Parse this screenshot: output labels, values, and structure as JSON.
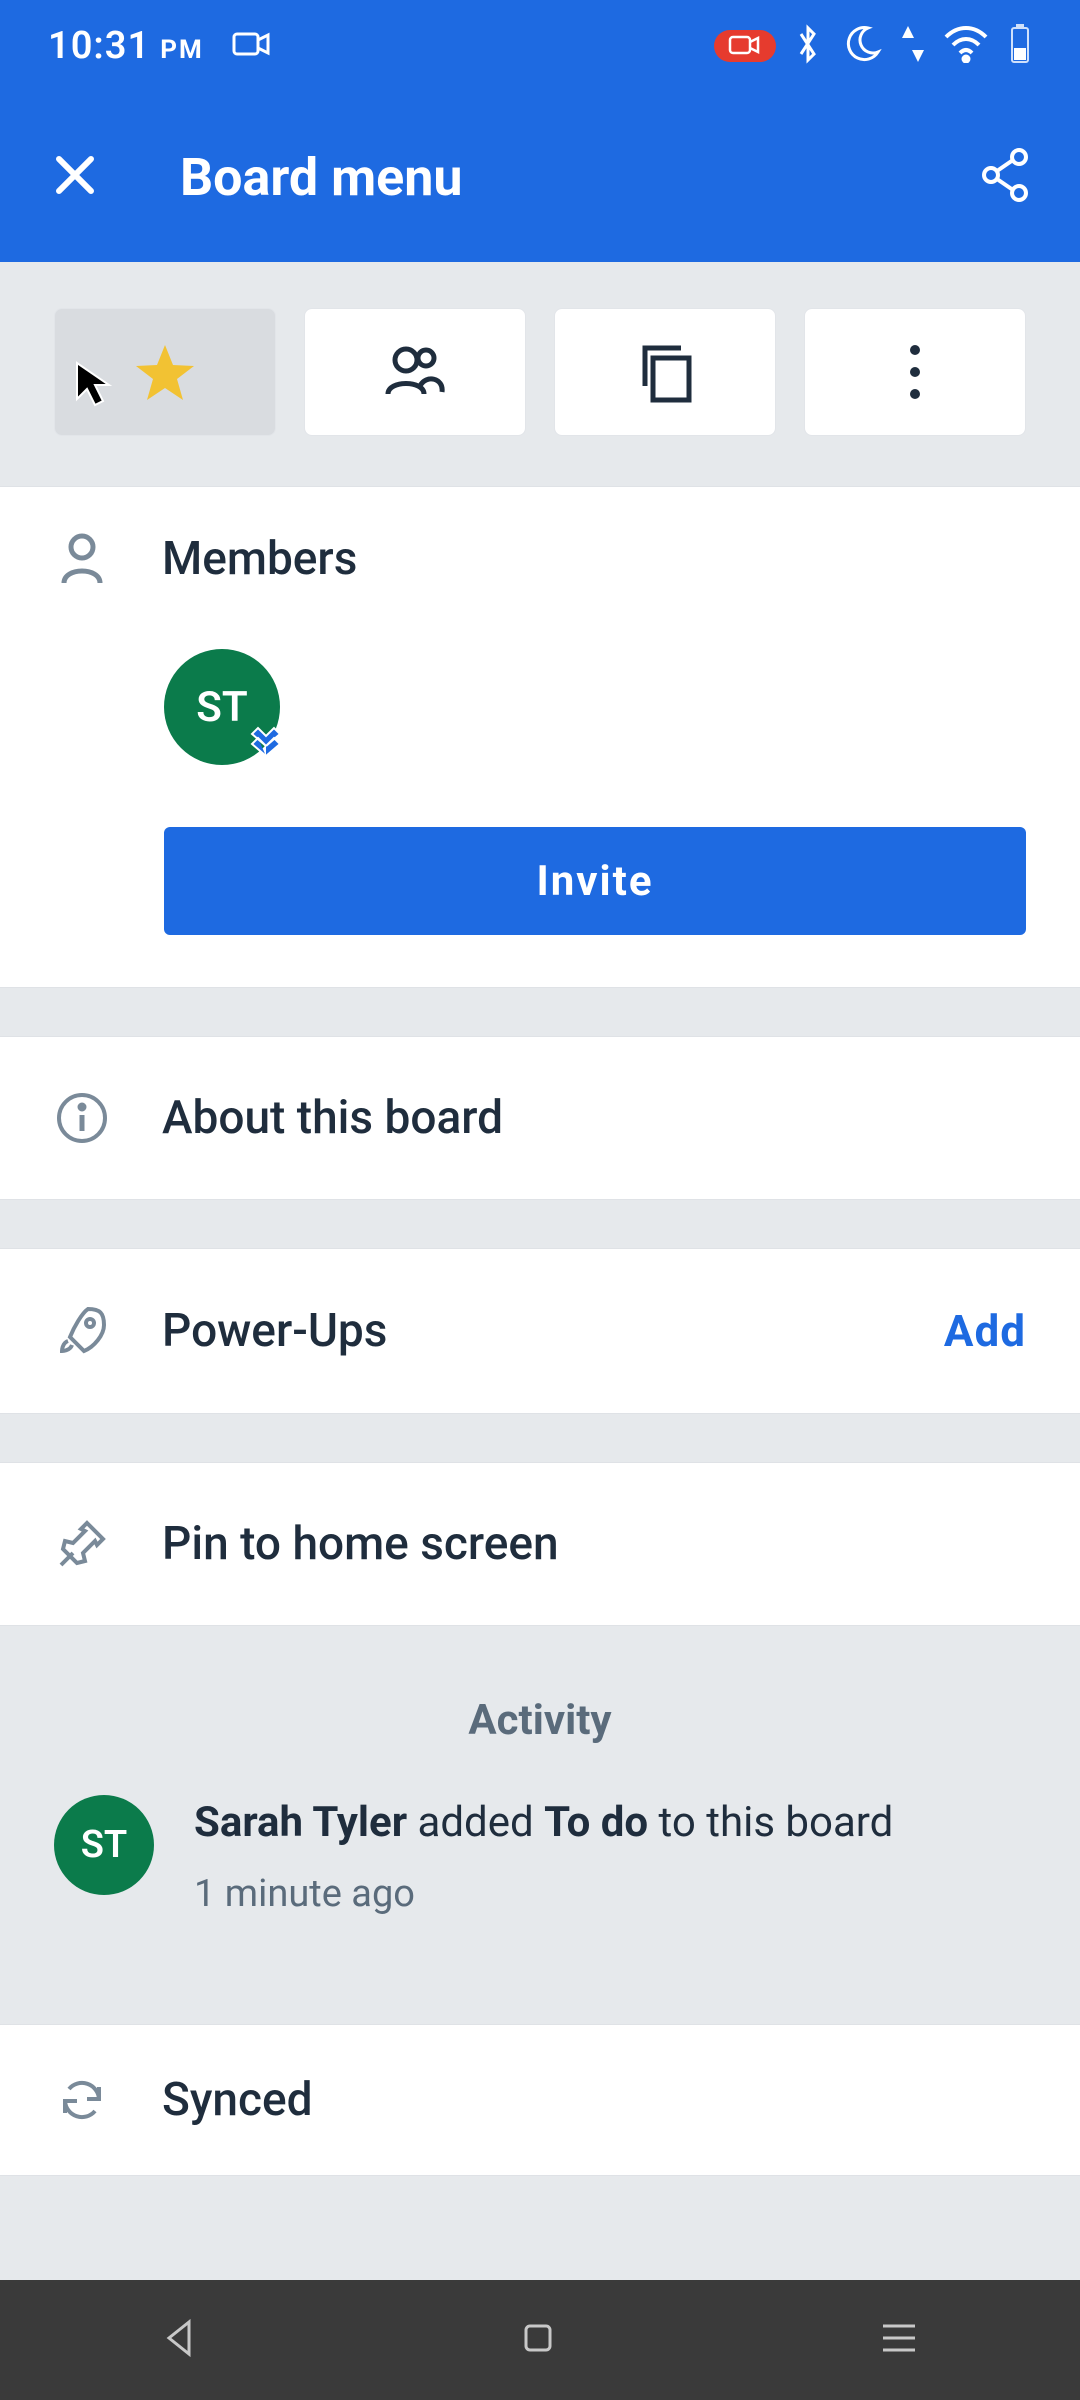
{
  "statusbar": {
    "time": "10:31",
    "ampm": "PM",
    "rec_indicator": true
  },
  "appbar": {
    "title": "Board menu"
  },
  "tabs": {
    "star_active": true
  },
  "members": {
    "header": "Members",
    "avatars": [
      {
        "initials": "ST",
        "color": "#0b7b4b",
        "admin": true
      }
    ],
    "invite_label": "Invite"
  },
  "rows": {
    "about": {
      "label": "About this board"
    },
    "powerups": {
      "label": "Power-Ups",
      "action": "Add"
    },
    "pin": {
      "label": "Pin to home screen"
    }
  },
  "activity": {
    "header": "Activity",
    "items": [
      {
        "initials": "ST",
        "actor": "Sarah Tyler",
        "verb": " added ",
        "object": "To do",
        "suffix": " to this board",
        "time": "1 minute ago"
      }
    ]
  },
  "sync": {
    "label": "Synced"
  }
}
